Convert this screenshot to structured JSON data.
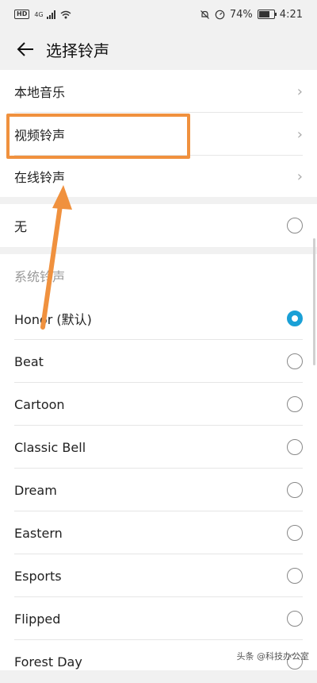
{
  "status_bar": {
    "hd": "HD",
    "network": "4G",
    "battery_percent": "74%",
    "battery_level": 0.74,
    "time": "4:21"
  },
  "header": {
    "title": "选择铃声"
  },
  "sources": [
    {
      "label": "本地音乐"
    },
    {
      "label": "视频铃声"
    },
    {
      "label": "在线铃声"
    }
  ],
  "none_option": {
    "label": "无",
    "selected": false
  },
  "system_section": {
    "title": "系统铃声",
    "items": [
      {
        "label": "Honor (默认)",
        "selected": true
      },
      {
        "label": "Beat",
        "selected": false
      },
      {
        "label": "Cartoon",
        "selected": false
      },
      {
        "label": "Classic Bell",
        "selected": false
      },
      {
        "label": "Dream",
        "selected": false
      },
      {
        "label": "Eastern",
        "selected": false
      },
      {
        "label": "Esports",
        "selected": false
      },
      {
        "label": "Flipped",
        "selected": false
      },
      {
        "label": "Forest Day",
        "selected": false
      }
    ]
  },
  "watermark": "头条 @科技办公室",
  "colors": {
    "accent": "#1aa0d6",
    "annotation": "#f0913e"
  }
}
